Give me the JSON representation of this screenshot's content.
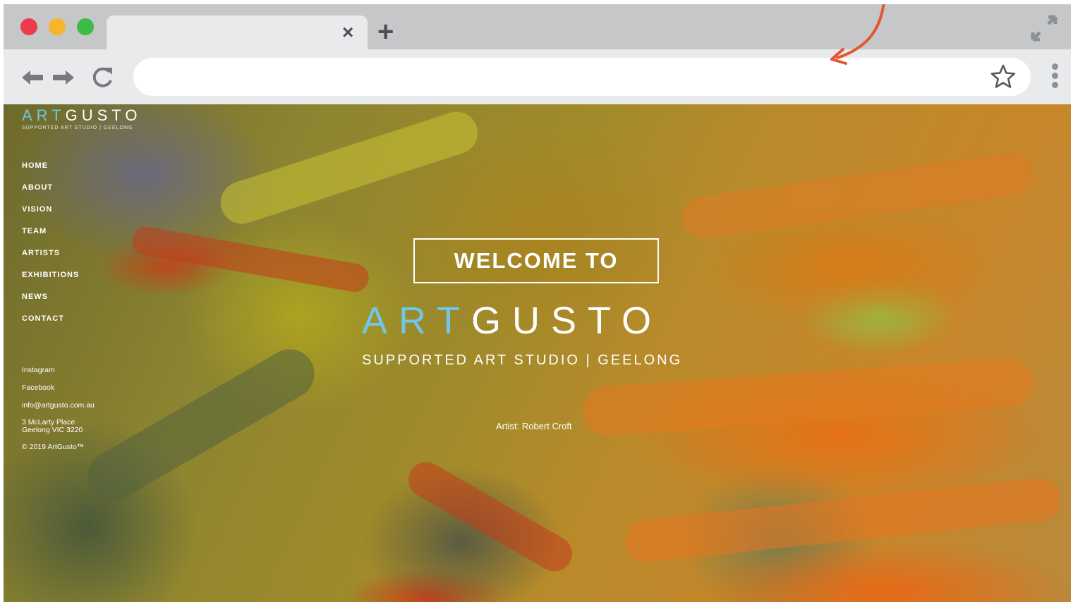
{
  "browser": {
    "tab_close": "×",
    "tab_new": "+",
    "address_value": "",
    "icons": [
      "back-arrow-icon",
      "forward-arrow-icon",
      "reload-icon",
      "star-icon",
      "kebab-menu-icon",
      "expand-icon",
      "annotation-arrow"
    ],
    "colors": {
      "annotation": "#e4572e",
      "frame": "#c6c7c9",
      "toolbar": "#e9eaeb"
    }
  },
  "site": {
    "logo": {
      "art": "ART",
      "gusto": "GUSTO",
      "sub": "SUPPORTED ART STUDIO | GEELONG"
    },
    "nav": [
      "HOME",
      "ABOUT",
      "VISION",
      "TEAM",
      "ARTISTS",
      "EXHIBITIONS",
      "NEWS",
      "CONTACT"
    ],
    "links": {
      "instagram": "Instagram",
      "facebook": "Facebook",
      "email": "info@artgusto.com.au",
      "address_line1": "3 McLarty Place",
      "address_line2": "Geelong VIC 3220",
      "copyright": "© 2019 ArtGusto™"
    },
    "hero": {
      "welcome": "WELCOME TO",
      "brand_art": "ART",
      "brand_gusto": "GUSTO",
      "tagline": "SUPPORTED ART STUDIO | GEELONG",
      "credit": "Artist: Robert Croft"
    },
    "colors": {
      "accent": "#6fc7e4",
      "text": "#ffffff"
    }
  }
}
